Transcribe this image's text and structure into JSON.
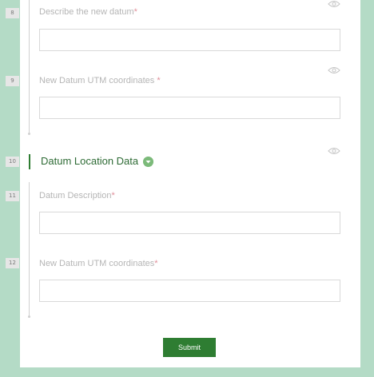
{
  "form": {
    "questions": [
      {
        "number": "8",
        "label": "Describe the new datum",
        "required_mark": "*",
        "value": ""
      },
      {
        "number": "9",
        "label": "New Datum UTM coordinates ",
        "required_mark": "*",
        "value": ""
      },
      {
        "number": "11",
        "label": "Datum Description",
        "required_mark": "*",
        "value": ""
      },
      {
        "number": "12",
        "label": "New Datum UTM coordinates",
        "required_mark": "*",
        "value": ""
      }
    ],
    "group": {
      "number": "10",
      "title": "Datum Location Data"
    },
    "submit_label": "Submit"
  },
  "icons": {
    "visibility": "eye-icon",
    "collapse": "chevron-down-icon"
  },
  "colors": {
    "page_background": "#b4dbc6",
    "accent_green": "#2e7d32",
    "required_mark": "#e08f9a"
  }
}
